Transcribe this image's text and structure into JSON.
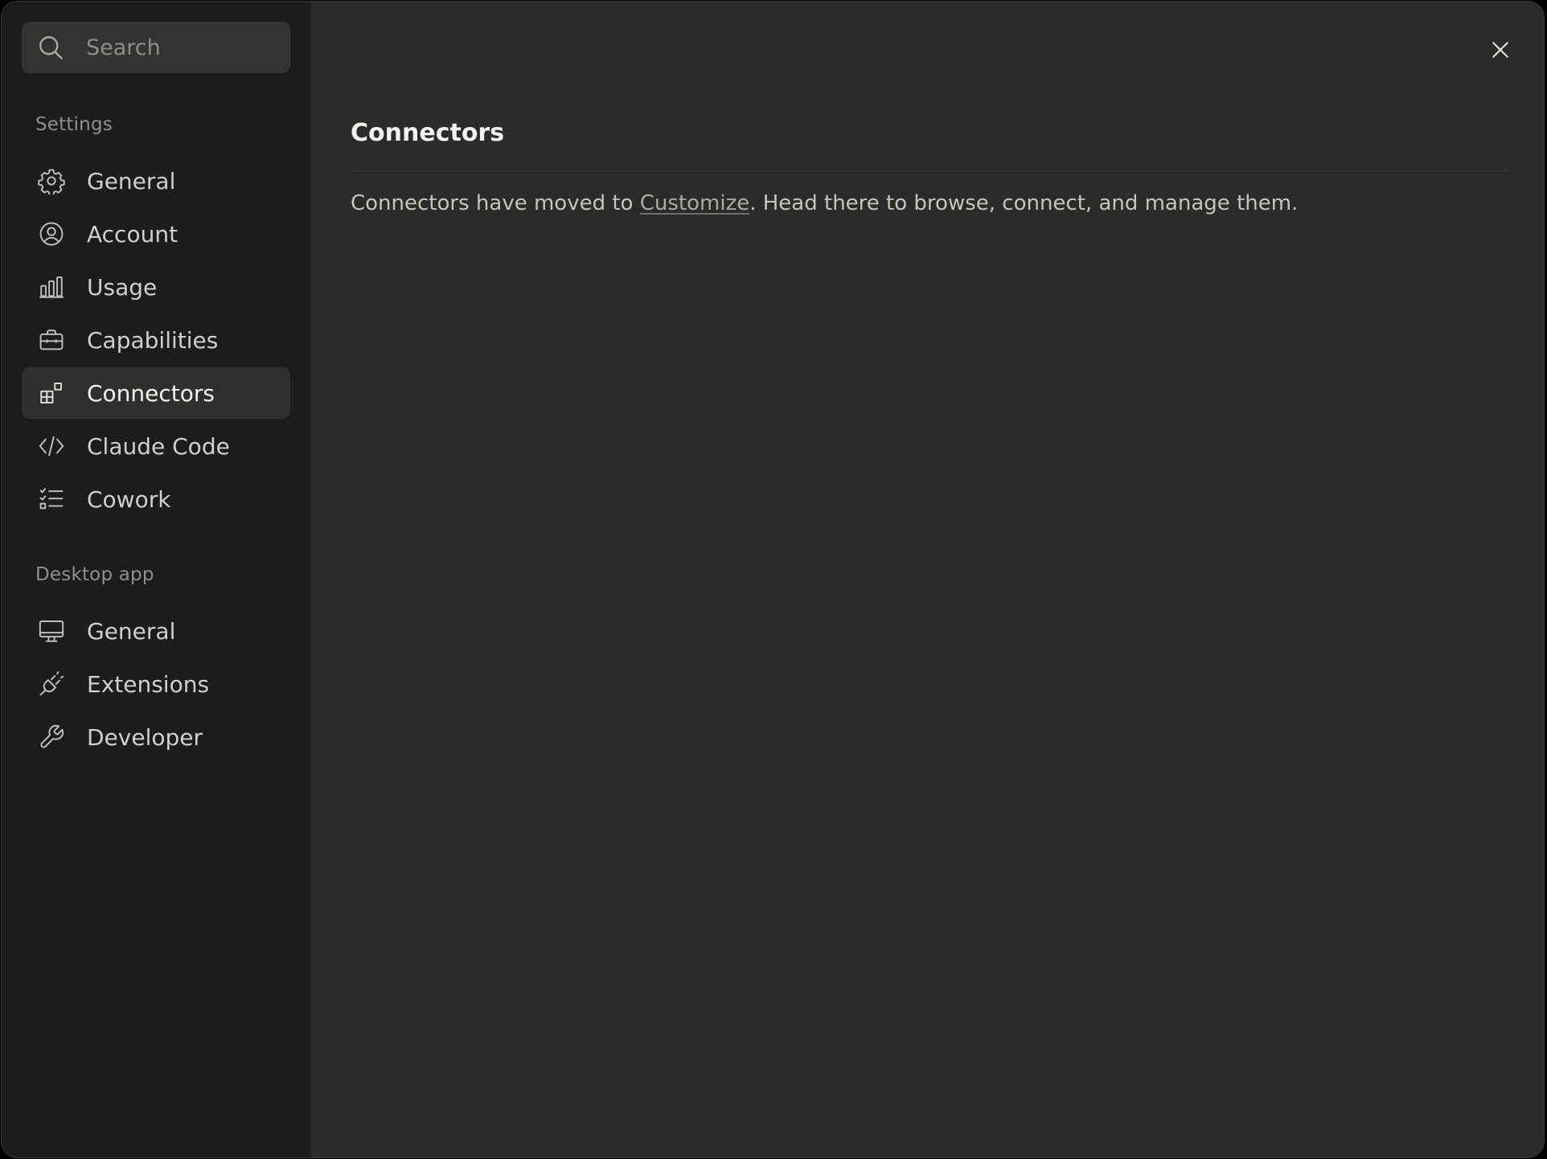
{
  "search": {
    "placeholder": "Search",
    "icon": "search-icon"
  },
  "sidebar": {
    "settings_heading": "Settings",
    "settings_items": [
      {
        "label": "General",
        "icon": "gear-icon",
        "active": false
      },
      {
        "label": "Account",
        "icon": "user-circle-icon",
        "active": false
      },
      {
        "label": "Usage",
        "icon": "bar-chart-icon",
        "active": false
      },
      {
        "label": "Capabilities",
        "icon": "briefcase-icon",
        "active": false
      },
      {
        "label": "Connectors",
        "icon": "connectors-grid-icon",
        "active": true
      },
      {
        "label": "Claude Code",
        "icon": "code-brackets-icon",
        "active": false
      },
      {
        "label": "Cowork",
        "icon": "checklist-icon",
        "active": false
      }
    ],
    "desktop_heading": "Desktop app",
    "desktop_items": [
      {
        "label": "General",
        "icon": "monitor-icon",
        "active": false
      },
      {
        "label": "Extensions",
        "icon": "plug-icon",
        "active": false
      },
      {
        "label": "Developer",
        "icon": "wrench-icon",
        "active": false
      }
    ]
  },
  "main": {
    "title": "Connectors",
    "message_before": "Connectors have moved to ",
    "message_link": "Customize",
    "message_after": ". Head there to browse, connect, and manage them."
  },
  "colors": {
    "sidebar_bg": "#1c1c1c",
    "main_bg": "#2b2b2a",
    "active_item_bg": "#2f2f2e",
    "text_primary": "#f3f3f0",
    "text_secondary": "#c4c4c0"
  },
  "close_icon": "close-icon"
}
